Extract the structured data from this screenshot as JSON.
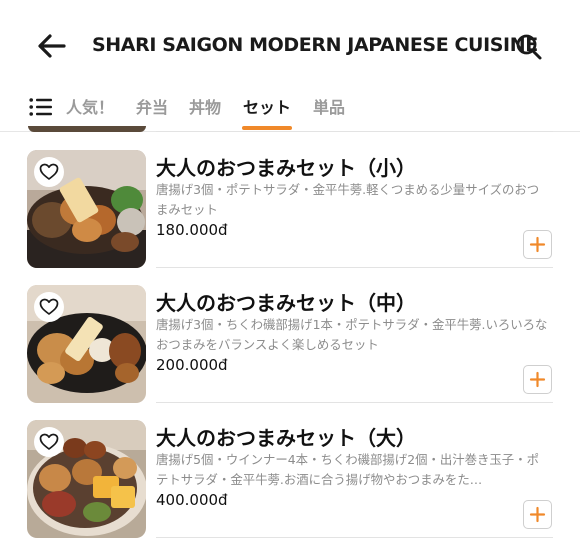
{
  "header": {
    "title": "SHARI SAIGON MODERN JAPANESE CUISINE"
  },
  "tabs": [
    {
      "label": "人気！"
    },
    {
      "label": "弁当"
    },
    {
      "label": "丼物"
    },
    {
      "label": "セット"
    },
    {
      "label": "単品"
    }
  ],
  "active_tab": "セット",
  "items": [
    {
      "name": "大人のおつまみセット（小）",
      "description": "唐揚げ3個・ポテトサラダ・金平牛蒡.軽くつまめる少量サイズのおつまみセット",
      "price": "180.000đ"
    },
    {
      "name": "大人のおつまみセット（中）",
      "description": "唐揚げ3個・ちくわ磯部揚げ1本・ポテトサラダ・金平牛蒡.いろいろなおつまみをバランスよく楽しめるセット",
      "price": "200.000đ"
    },
    {
      "name": "大人のおつまみセット（大）",
      "description": "唐揚げ5個・ウインナー4本・ちくわ磯部揚げ2個・出汁巻き玉子・ポテトサラダ・金平牛蒡.お酒に合う揚げ物やおつまみをた…",
      "price": "400.000đ"
    }
  ],
  "icons": {
    "back": "arrow-left-icon",
    "search": "search-icon",
    "menu": "menu-list-icon",
    "favorite": "heart-icon",
    "add": "plus-icon"
  },
  "colors": {
    "accent": "#f0892a",
    "tab_inactive": "#9a9a9a",
    "description": "#8c8c8c"
  }
}
